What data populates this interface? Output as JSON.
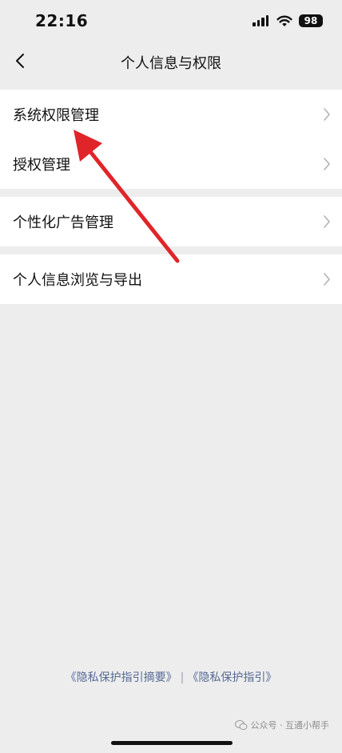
{
  "status_bar": {
    "time": "22:16",
    "battery": "98",
    "icons": [
      "signal-icon",
      "wifi-icon",
      "battery-icon"
    ]
  },
  "navbar": {
    "back_icon": "chevron-left-icon",
    "title": "个人信息与权限"
  },
  "groups": [
    {
      "items": [
        {
          "label": "系统权限管理"
        },
        {
          "label": "授权管理"
        }
      ]
    },
    {
      "items": [
        {
          "label": "个性化广告管理"
        }
      ]
    },
    {
      "items": [
        {
          "label": "个人信息浏览与导出"
        }
      ]
    }
  ],
  "footer": {
    "link1": "《隐私保护指引摘要》",
    "separator": "|",
    "link2": "《隐私保护指引》"
  },
  "watermark": {
    "text": "公众号 · 互通小帮手"
  },
  "annotation": {
    "color": "#e0252a"
  },
  "colors": {
    "background": "#ededed",
    "link": "#576b95"
  }
}
